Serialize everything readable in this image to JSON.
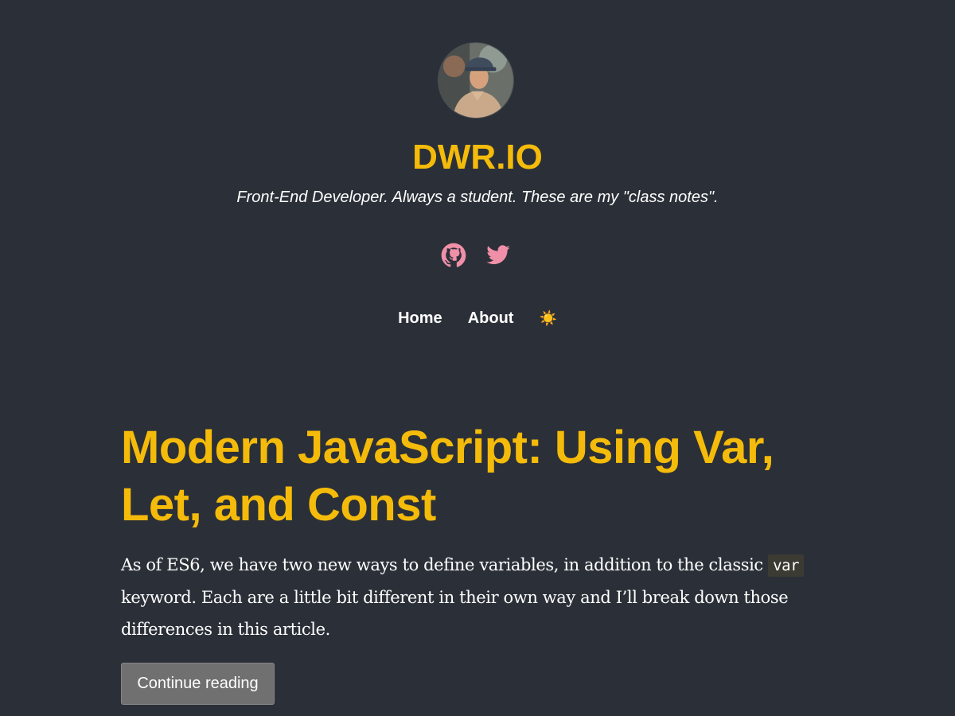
{
  "header": {
    "site_title": "DWR.IO",
    "tagline": "Front-End Developer. Always a student. These are my \"class notes\"."
  },
  "social": {
    "icons": [
      "github-icon",
      "twitter-icon"
    ],
    "icon_color": "#f090a8"
  },
  "nav": {
    "items": [
      {
        "label": "Home"
      },
      {
        "label": "About"
      }
    ],
    "theme_toggle": "☀️"
  },
  "post": {
    "title": "Modern JavaScript: Using Var, Let, and Const",
    "excerpt_before": "As of ES6, we have two new ways to define variables, in addition to the classic ",
    "excerpt_code": "var",
    "excerpt_after": " keyword. Each are a little bit different in their own way and I’ll break down those differences in this article.",
    "continue_label": "Continue reading"
  },
  "colors": {
    "background": "#2b3038",
    "accent": "#f5bb0a",
    "button": "#707070"
  }
}
